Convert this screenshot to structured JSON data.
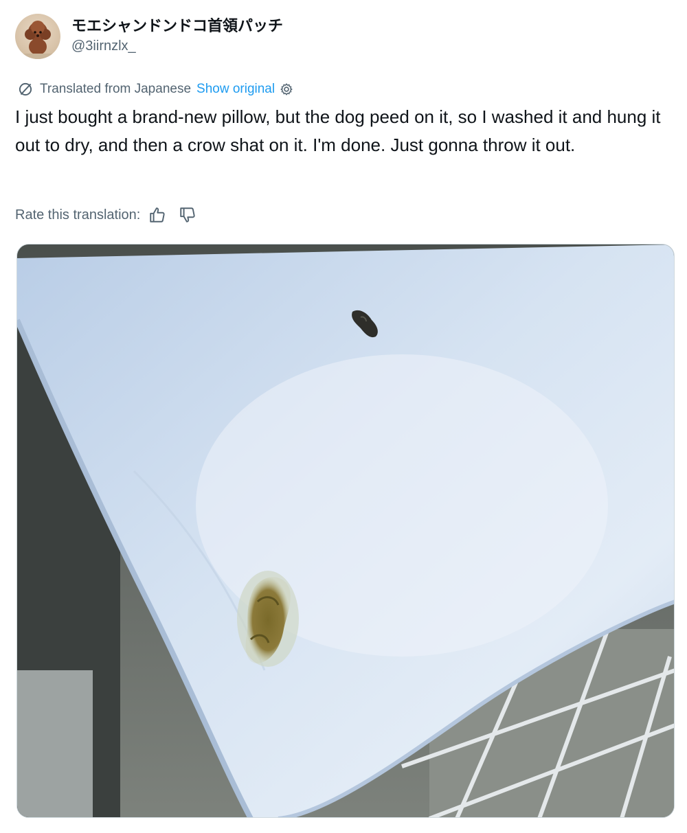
{
  "author": {
    "display_name": "モエシャンドンドコ首領パッチ",
    "handle": "@3iirnzlx_"
  },
  "translation": {
    "label": "Translated from Japanese",
    "show_original": "Show original"
  },
  "tweet": {
    "text": "I just bought a brand-new pillow, but the dog peed on it, so I washed it and hung it out to dry, and then a crow shat on it. I'm done. Just gonna throw it out."
  },
  "rate": {
    "label": "Rate this translation:"
  },
  "icons": {
    "translate": "translate-icon",
    "settings": "gear-icon",
    "thumbs_up": "thumbs-up-icon",
    "thumbs_down": "thumbs-down-icon"
  },
  "colors": {
    "link": "#1d9bf0",
    "secondary_text": "#536471",
    "primary_text": "#0f1419"
  }
}
